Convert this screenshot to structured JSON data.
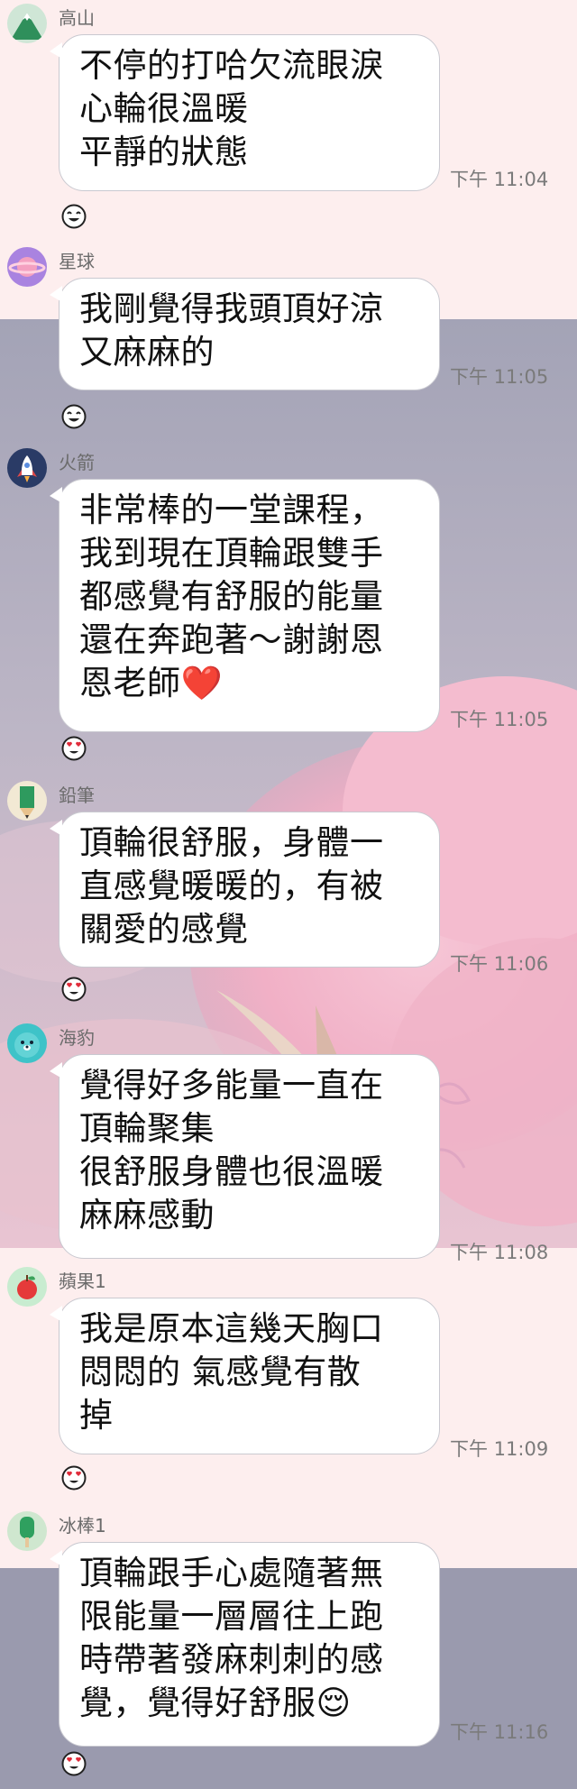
{
  "chat": {
    "messages": [
      {
        "sender": "高山",
        "avatar": "mountain-icon",
        "text": "不停的打哈欠流眼淚\n心輪很溫暖\n平靜的狀態",
        "time": "下午 11:04",
        "reaction": "laughing-face-icon"
      },
      {
        "sender": "星球",
        "avatar": "planet-icon",
        "text": "我剛覺得我頭頂好涼\n又麻麻的",
        "time": "下午 11:05",
        "reaction": "laughing-face-icon"
      },
      {
        "sender": "火箭",
        "avatar": "rocket-icon",
        "text": "非常棒的一堂課程，\n我到現在頂輪跟雙手\n都感覺有舒服的能量\n還在奔跑著～謝謝恩\n恩老師❤️",
        "time": "下午 11:05",
        "reaction": "heart-eyes-face-icon"
      },
      {
        "sender": "鉛筆",
        "avatar": "pencil-icon",
        "text": "頂輪很舒服，身體一\n直感覺暖暖的，有被\n關愛的感覺",
        "time": "下午 11:06",
        "reaction": "heart-eyes-face-icon"
      },
      {
        "sender": "海豹",
        "avatar": "seal-icon",
        "text": "覺得好多能量一直在\n頂輪聚集\n很舒服身體也很溫暖\n麻麻感動",
        "time": "下午 11:08",
        "reaction": null
      },
      {
        "sender": "蘋果1",
        "avatar": "apple-icon",
        "text": "我是原本這幾天胸口\n悶悶的 氣感覺有散\n掉",
        "time": "下午 11:09",
        "reaction": "heart-eyes-face-icon"
      },
      {
        "sender": "冰棒1",
        "avatar": "popsicle-icon",
        "text": "頂輪跟手心處隨著無\n限能量一層層往上跑\n時帶著發麻刺刺的感\n覺，覺得好舒服😌",
        "time": "下午 11:16",
        "reaction": "heart-eyes-face-icon"
      }
    ]
  },
  "colors": {
    "bg_pink": "#fdeeee",
    "bg_slate": "#9a9aae",
    "cloud_pink": "#f3b8cc",
    "bubble": "#ffffff",
    "bubble_border": "#c9c9d0",
    "text": "#111111",
    "meta_text": "#7a7a7a"
  }
}
